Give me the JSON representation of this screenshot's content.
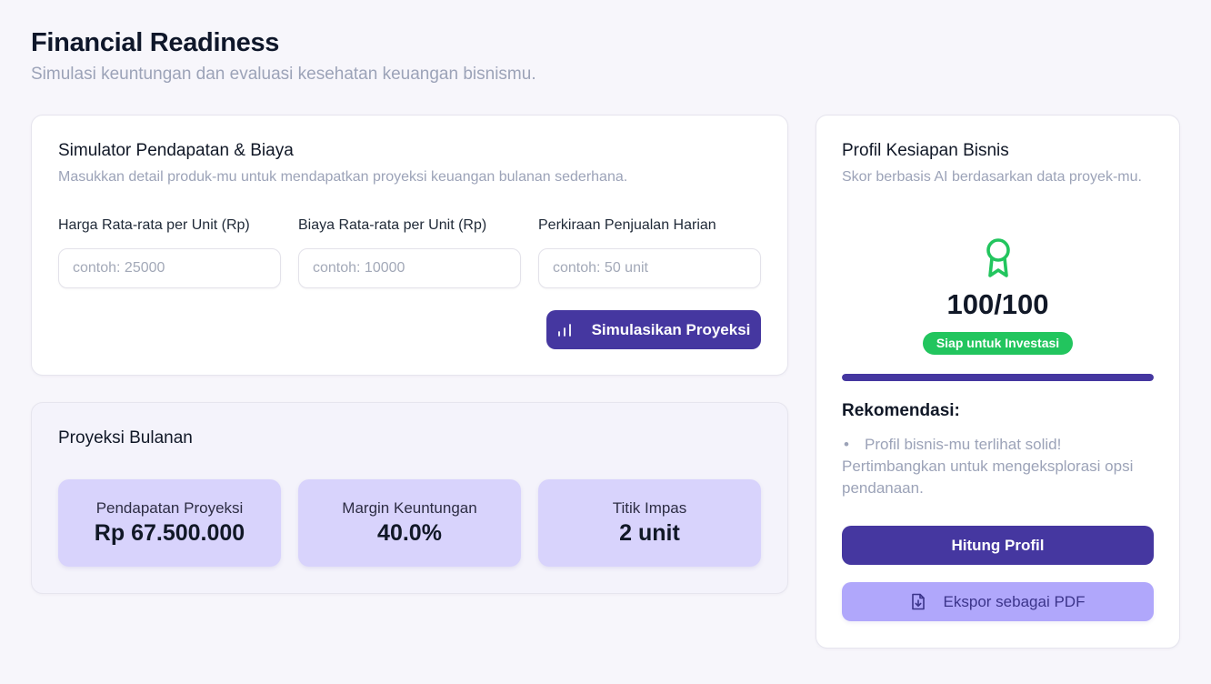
{
  "header": {
    "title": "Financial Readiness",
    "subtitle": "Simulasi keuntungan dan evaluasi kesehatan keuangan bisnismu."
  },
  "simulator": {
    "title": "Simulator Pendapatan & Biaya",
    "description": "Masukkan detail produk-mu untuk mendapatkan proyeksi keuangan bulanan sederhana.",
    "fields": [
      {
        "label": "Harga Rata-rata per Unit (Rp)",
        "value": "",
        "placeholder": "contoh: 25000"
      },
      {
        "label": "Biaya Rata-rata per Unit (Rp)",
        "value": "",
        "placeholder": "contoh: 10000"
      },
      {
        "label": "Perkiraan Penjualan Harian",
        "value": "",
        "placeholder": "contoh: 50 unit"
      }
    ],
    "submit_label": "Simulasikan Proyeksi",
    "submit_icon": "bar-chart-icon"
  },
  "projection": {
    "title": "Proyeksi Bulanan",
    "stats": [
      {
        "label": "Pendapatan Proyeksi",
        "value": "Rp 67.500.000"
      },
      {
        "label": "Margin Keuntungan",
        "value": "40.0%"
      },
      {
        "label": "Titik Impas",
        "value": "2 unit"
      }
    ]
  },
  "profile": {
    "title": "Profil Kesiapan Bisnis",
    "description": "Skor berbasis AI berdasarkan data proyek-mu.",
    "icon": "award-icon",
    "score": "100/100",
    "score_fraction": 1.0,
    "badge": "Siap untuk Investasi",
    "recommendation_heading": "Rekomendasi:",
    "recommendations": [
      "Profil bisnis-mu terlihat solid! Pertimbangkan untuk mengeksplorasi opsi pendanaan."
    ],
    "calculate_label": "Hitung Profil",
    "export_label": "Ekspor sebagai PDF",
    "export_icon": "file-download-icon"
  },
  "colors": {
    "primary": "#4537a0",
    "stat_background": "#d8d3fc",
    "success": "#22c55e",
    "export_button": "#b0a7fb"
  }
}
